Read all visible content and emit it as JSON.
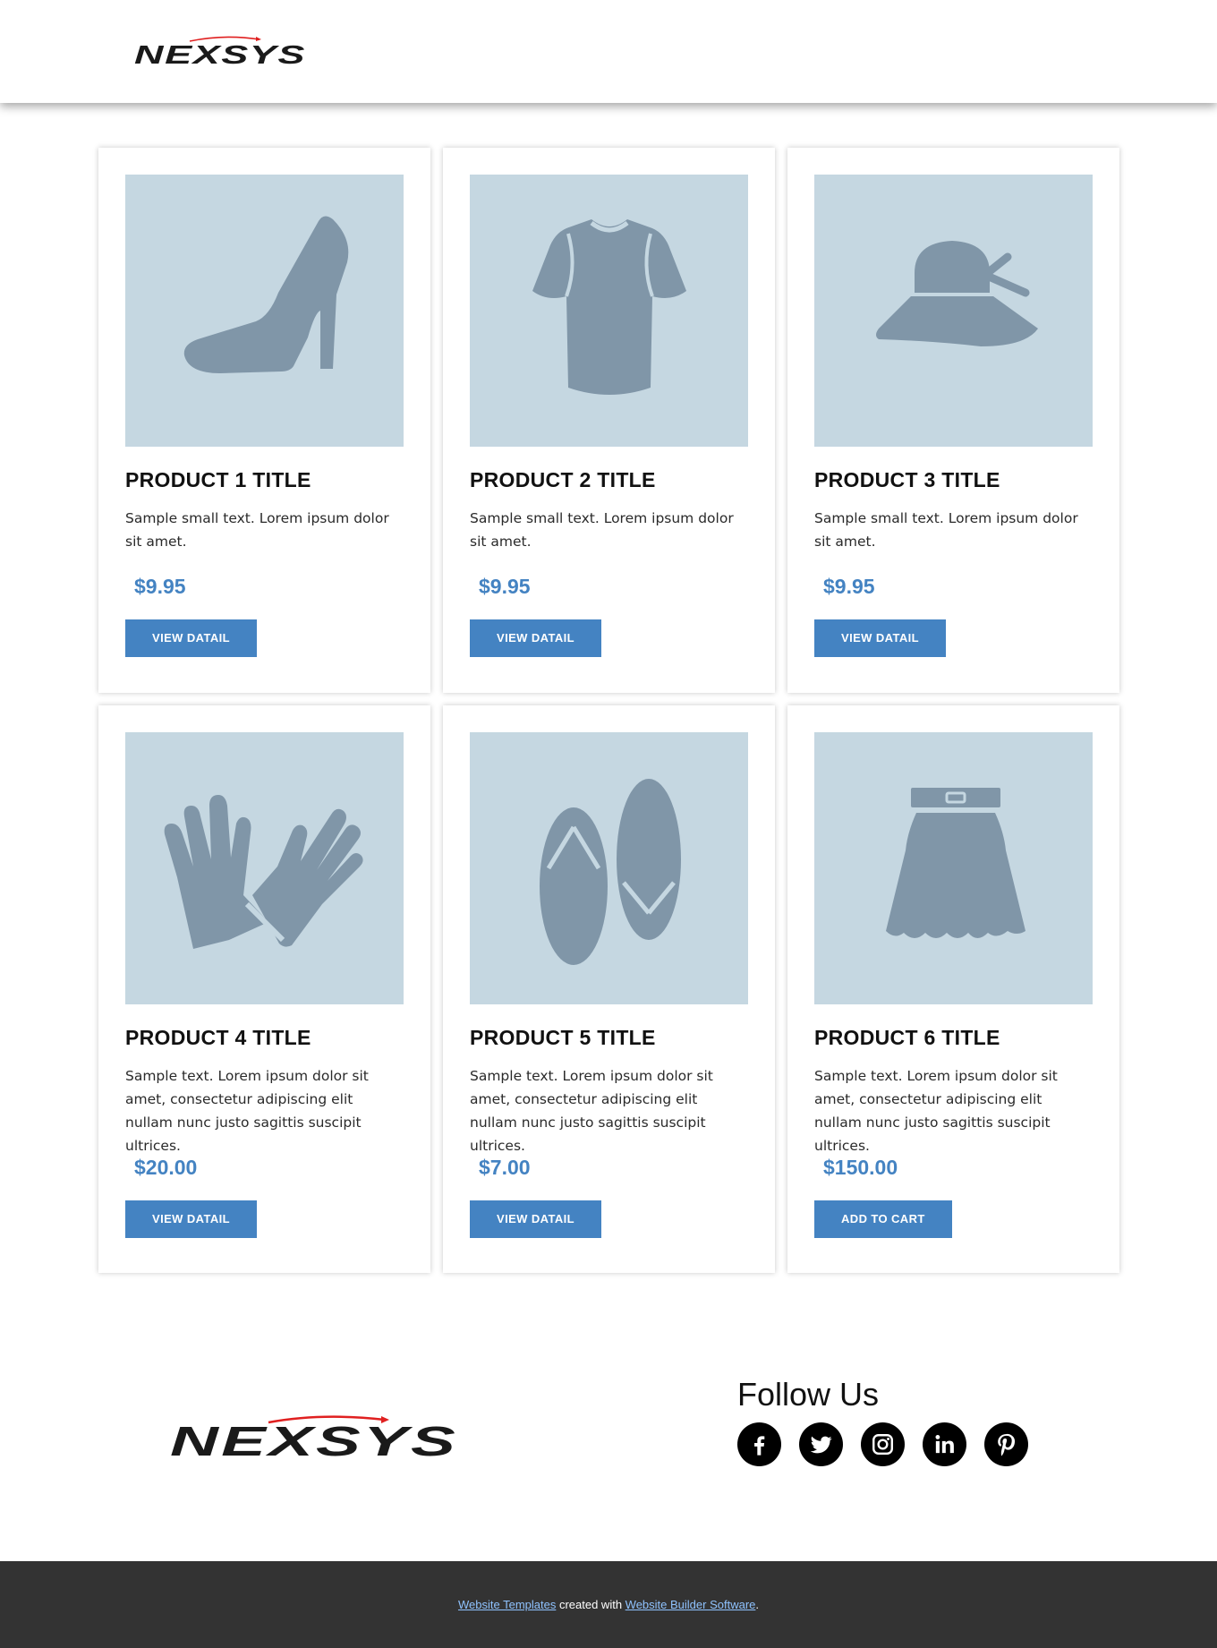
{
  "header": {
    "logo_text": "NEXSYS"
  },
  "products": [
    {
      "title": "PRODUCT 1 TITLE",
      "description": "Sample small text. Lorem ipsum dolor sit amet.",
      "price": "$9.95",
      "button": "VIEW DATAIL",
      "icon": "high-heel-shoe-icon"
    },
    {
      "title": "PRODUCT 2 TITLE",
      "description": "Sample small text. Lorem ipsum dolor sit amet.",
      "price": "$9.95",
      "button": "VIEW DATAIL",
      "icon": "t-shirt-icon"
    },
    {
      "title": "PRODUCT 3 TITLE",
      "description": "Sample small text. Lorem ipsum dolor sit amet.",
      "price": "$9.95",
      "button": "VIEW DATAIL",
      "icon": "sun-hat-icon"
    },
    {
      "title": "PRODUCT 4 TITLE",
      "description": "Sample text. Lorem ipsum dolor sit amet, consectetur adipiscing elit nullam nunc justo sagittis suscipit ultrices.",
      "price": "$20.00",
      "button": "VIEW DATAIL",
      "icon": "gloves-icon"
    },
    {
      "title": "PRODUCT 5 TITLE",
      "description": "Sample text. Lorem ipsum dolor sit amet, consectetur adipiscing elit nullam nunc justo sagittis suscipit ultrices.",
      "price": "$7.00",
      "button": "VIEW DATAIL",
      "icon": "flip-flops-icon"
    },
    {
      "title": "PRODUCT 6 TITLE",
      "description": "Sample text. Lorem ipsum dolor sit amet, consectetur adipiscing elit nullam nunc justo sagittis suscipit ultrices.",
      "price": "$150.00",
      "button": "ADD TO CART",
      "icon": "skirt-icon"
    }
  ],
  "footer": {
    "logo_text": "NEXSYS",
    "follow_title": "Follow Us",
    "socials": [
      "facebook-icon",
      "twitter-icon",
      "instagram-icon",
      "linkedin-icon",
      "pinterest-icon"
    ],
    "credit": {
      "link1": "Website Templates",
      "middle": " created with ",
      "link2": "Website Builder Software",
      "end": "."
    }
  },
  "colors": {
    "accent": "#4483c2",
    "image_bg": "#c5d7e1",
    "icon_fill": "#8096a8",
    "footer_bar": "#333333",
    "logo_red": "#e02020"
  }
}
